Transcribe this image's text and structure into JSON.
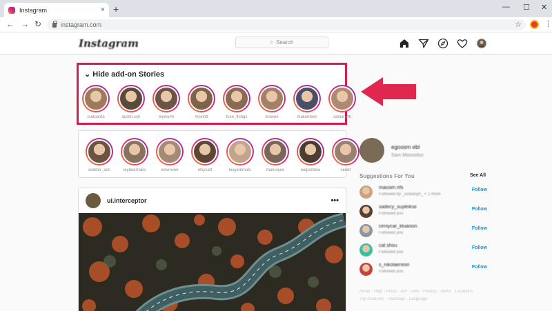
{
  "browser": {
    "tab_title": "Instagram",
    "tab_close": "×",
    "new_tab": "+",
    "minimize": "—",
    "maximize": "☐",
    "close": "✕",
    "back": "←",
    "forward": "→",
    "reload": "↻",
    "url": "instagram.com",
    "star": "☆",
    "menu": "⋮"
  },
  "header": {
    "logo": "Instagram",
    "search_placeholder": "Search",
    "search_icon": "⌕"
  },
  "addon_stories": {
    "toggle_label": "⌄ Hide add-on Stories",
    "items": [
      {
        "name": "ouduarda",
        "color": "#9c7a5a"
      },
      {
        "name": "dustin.sch",
        "color": "#5a4a3a"
      },
      {
        "name": "elyesinh",
        "color": "#6e5444"
      },
      {
        "name": "moxlott",
        "color": "#7d6348"
      },
      {
        "name": "fuse_things",
        "color": "#8a6a52"
      },
      {
        "name": "mowoe",
        "color": "#a38066"
      },
      {
        "name": "makenlees",
        "color": "#4a4e6a"
      },
      {
        "name": "samanvth",
        "color": "#b08972"
      }
    ]
  },
  "stories": {
    "items": [
      {
        "name": "dodder_ach",
        "color": "#6b5442"
      },
      {
        "name": "laydoernaks",
        "color": "#8a7260"
      },
      {
        "name": "kelvinven",
        "color": "#a48a74"
      },
      {
        "name": "elsycatt",
        "color": "#5c4634"
      },
      {
        "name": "kiayemmuts",
        "color": "#c2a48c"
      },
      {
        "name": "manuojeo",
        "color": "#7b665a"
      },
      {
        "name": "leepanilow",
        "color": "#4c3d33"
      },
      {
        "name": "sendr",
        "color": "#9a8070"
      }
    ]
  },
  "post": {
    "username": "ui.interceptor",
    "more": "•••"
  },
  "sidebar": {
    "username": "egoosm ebl",
    "full_name": "Sam Moonsfun",
    "suggestions_title": "Suggestions For You",
    "see_all": "See All",
    "suggestions": [
      {
        "user": "massim.nfs",
        "sub": "Followed by _uswanyh_ + 1 more",
        "color": "#c9a27e",
        "follow": "Follow"
      },
      {
        "user": "sadecy_suyleikse",
        "sub": "Followed you",
        "color": "#5a4030",
        "follow": "Follow"
      },
      {
        "user": "ceniycar_kluaison",
        "sub": "Followed you",
        "color": "#8a97a3",
        "follow": "Follow"
      },
      {
        "user": "cat.shou",
        "sub": "Followed you",
        "color": "#3bbfa3",
        "follow": "Follow"
      },
      {
        "user": "s_nikolaeniniri",
        "sub": "Followed you",
        "color": "#c4453a",
        "follow": "Follow"
      }
    ],
    "footer_line1": "About · Help · Press · API · Jobs · Privacy · Terms · Locations",
    "footer_line2": "Top Accounts · Hashtags · Language"
  }
}
